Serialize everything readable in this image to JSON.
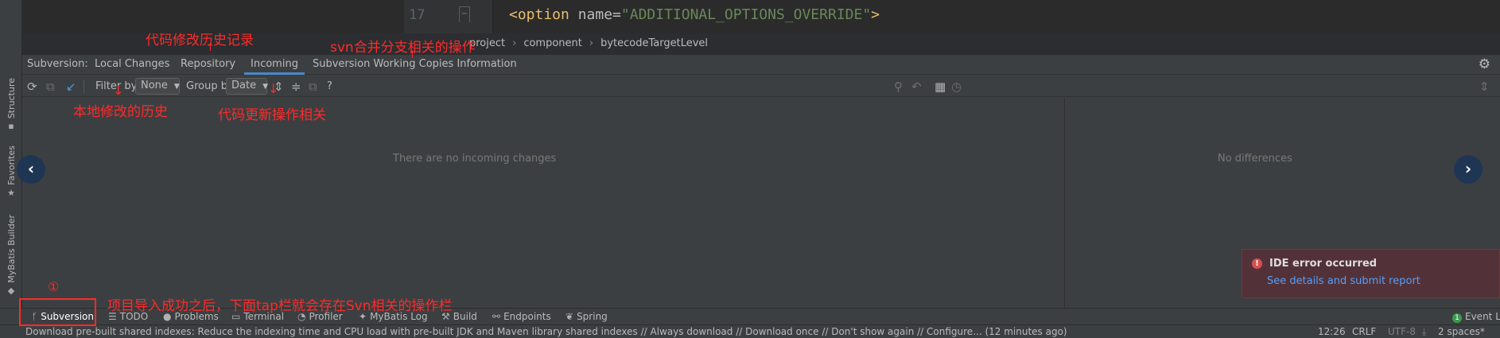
{
  "editor": {
    "line_number": "17",
    "code": {
      "tag_open": "<option",
      "attr": " name=",
      "value": "\"ADDITIONAL_OPTIONS_OVERRIDE\"",
      "tag_close": ">"
    }
  },
  "breadcrumb": [
    "project",
    "component",
    "bytecodeTargetLevel"
  ],
  "left_strip": {
    "structure": "Structure",
    "favorites": "Favorites",
    "mybatis": "MyBatis Builder"
  },
  "subversion": {
    "prefix": "Subversion:",
    "tabs": [
      "Local Changes",
      "Repository",
      "Incoming",
      "Subversion Working Copies Information"
    ],
    "active_tab": "Incoming"
  },
  "toolbar": {
    "filter_label": "Filter by",
    "filter_value": "None",
    "group_label": "Group by",
    "group_value": "Date",
    "help": "?"
  },
  "panels": {
    "left_empty": "There are no incoming changes",
    "right_empty": "No differences"
  },
  "error_popup": {
    "title": "IDE error occurred",
    "link": "See details and submit report"
  },
  "tool_tabs": [
    "Subversion",
    "TODO",
    "Problems",
    "Terminal",
    "Profiler",
    "MyBatis Log",
    "Build",
    "Endpoints",
    "Spring"
  ],
  "event_log": {
    "count": "1",
    "label": "Event L"
  },
  "status": {
    "message": "Download pre-built shared indexes: Reduce the indexing time and CPU load with pre-built JDK and Maven library shared indexes // Always download // Download once // Don't show again // Configure... (12 minutes ago)",
    "position": "12:26",
    "line_sep": "CRLF",
    "encoding": "UTF-8",
    "indent": "2 spaces*"
  },
  "annotations": {
    "history": "代码修改历史记录",
    "branch": "svn合并分支相关的操作",
    "local": "本地修改的历史",
    "update": "代码更新操作相关",
    "circled_num": "①",
    "bottom_note": "项目导入成功之后，下面tap栏就会存在Svn相关的操作栏"
  },
  "colors": {
    "accent": "#4a88c7",
    "annotation": "#ff2a2a",
    "error_bg": "#523238",
    "link": "#589df6"
  }
}
